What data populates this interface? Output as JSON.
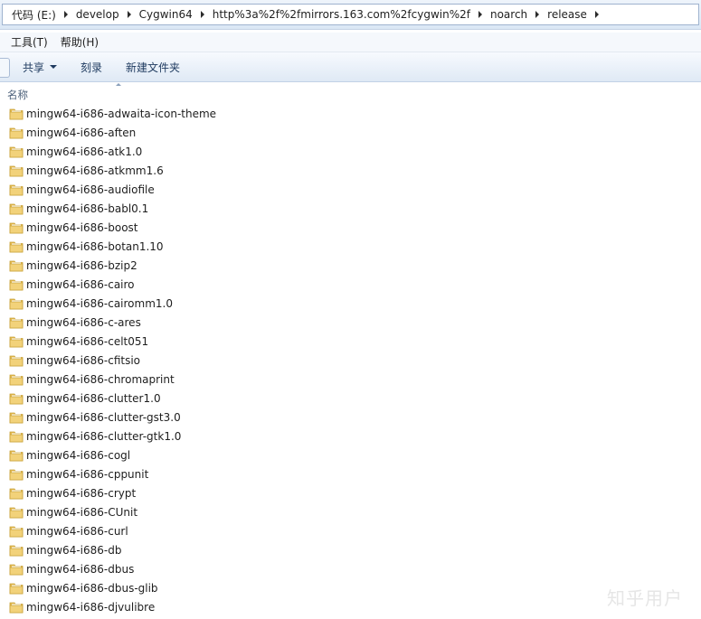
{
  "breadcrumb": {
    "items": [
      "代码 (E:)",
      "develop",
      "Cygwin64",
      "http%3a%2f%2fmirrors.163.com%2fcygwin%2f",
      "noarch",
      "release"
    ]
  },
  "menu": {
    "items": [
      "工具(T)",
      "帮助(H)"
    ]
  },
  "toolbar": {
    "share_label": "共享",
    "burn_label": "刻录",
    "new_folder_label": "新建文件夹"
  },
  "columns": {
    "name": "名称"
  },
  "files": [
    "mingw64-i686-adwaita-icon-theme",
    "mingw64-i686-aften",
    "mingw64-i686-atk1.0",
    "mingw64-i686-atkmm1.6",
    "mingw64-i686-audiofile",
    "mingw64-i686-babl0.1",
    "mingw64-i686-boost",
    "mingw64-i686-botan1.10",
    "mingw64-i686-bzip2",
    "mingw64-i686-cairo",
    "mingw64-i686-cairomm1.0",
    "mingw64-i686-c-ares",
    "mingw64-i686-celt051",
    "mingw64-i686-cfitsio",
    "mingw64-i686-chromaprint",
    "mingw64-i686-clutter1.0",
    "mingw64-i686-clutter-gst3.0",
    "mingw64-i686-clutter-gtk1.0",
    "mingw64-i686-cogl",
    "mingw64-i686-cppunit",
    "mingw64-i686-crypt",
    "mingw64-i686-CUnit",
    "mingw64-i686-curl",
    "mingw64-i686-db",
    "mingw64-i686-dbus",
    "mingw64-i686-dbus-glib",
    "mingw64-i686-djvulibre"
  ],
  "watermark": "知乎用户",
  "icons": {
    "folder": "folder-icon",
    "separator": "chevron-right-icon",
    "dropdown": "chevron-down-icon"
  },
  "colors": {
    "folder_fill": "#f2d27a",
    "folder_edge": "#c9a23a"
  }
}
